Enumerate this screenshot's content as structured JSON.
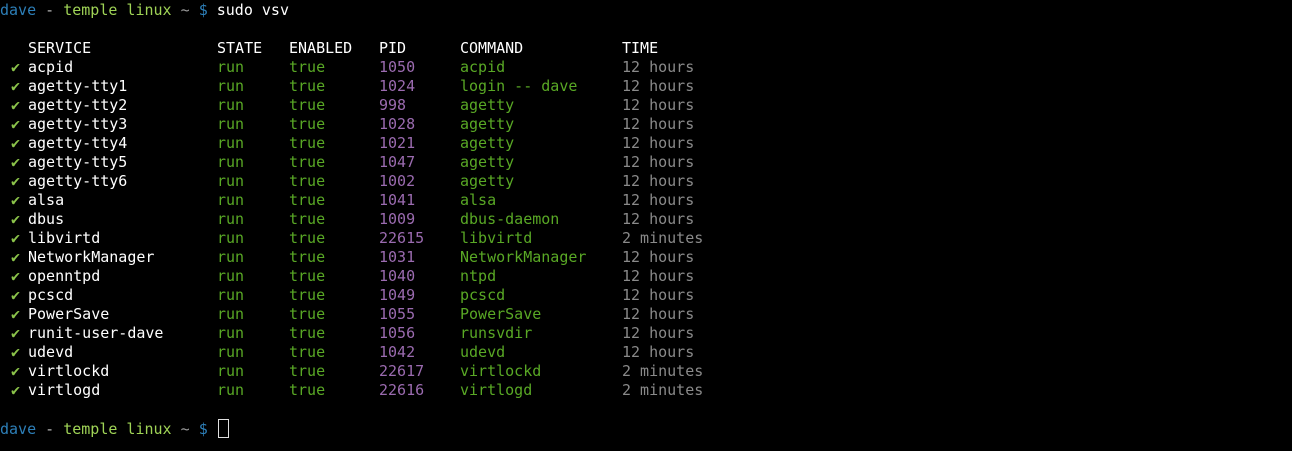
{
  "prompt": {
    "user": "dave",
    "separator": " - ",
    "host": "temple linux",
    "path": " ~ ",
    "symbol": "$"
  },
  "command": "sudo vsv",
  "columns": {
    "service": "SERVICE",
    "state": "STATE",
    "enabled": "ENABLED",
    "pid": "PID",
    "command": "COMMAND",
    "time": "TIME"
  },
  "check_symbol": "✔",
  "rows": [
    {
      "service": "acpid",
      "state": "run",
      "enabled": "true",
      "pid": "1050",
      "command": "acpid",
      "time": "12 hours"
    },
    {
      "service": "agetty-tty1",
      "state": "run",
      "enabled": "true",
      "pid": "1024",
      "command": "login -- dave",
      "time": "12 hours"
    },
    {
      "service": "agetty-tty2",
      "state": "run",
      "enabled": "true",
      "pid": "998",
      "command": "agetty",
      "time": "12 hours"
    },
    {
      "service": "agetty-tty3",
      "state": "run",
      "enabled": "true",
      "pid": "1028",
      "command": "agetty",
      "time": "12 hours"
    },
    {
      "service": "agetty-tty4",
      "state": "run",
      "enabled": "true",
      "pid": "1021",
      "command": "agetty",
      "time": "12 hours"
    },
    {
      "service": "agetty-tty5",
      "state": "run",
      "enabled": "true",
      "pid": "1047",
      "command": "agetty",
      "time": "12 hours"
    },
    {
      "service": "agetty-tty6",
      "state": "run",
      "enabled": "true",
      "pid": "1002",
      "command": "agetty",
      "time": "12 hours"
    },
    {
      "service": "alsa",
      "state": "run",
      "enabled": "true",
      "pid": "1041",
      "command": "alsa",
      "time": "12 hours"
    },
    {
      "service": "dbus",
      "state": "run",
      "enabled": "true",
      "pid": "1009",
      "command": "dbus-daemon",
      "time": "12 hours"
    },
    {
      "service": "libvirtd",
      "state": "run",
      "enabled": "true",
      "pid": "22615",
      "command": "libvirtd",
      "time": "2 minutes"
    },
    {
      "service": "NetworkManager",
      "state": "run",
      "enabled": "true",
      "pid": "1031",
      "command": "NetworkManager",
      "time": "12 hours"
    },
    {
      "service": "openntpd",
      "state": "run",
      "enabled": "true",
      "pid": "1040",
      "command": "ntpd",
      "time": "12 hours"
    },
    {
      "service": "pcscd",
      "state": "run",
      "enabled": "true",
      "pid": "1049",
      "command": "pcscd",
      "time": "12 hours"
    },
    {
      "service": "PowerSave",
      "state": "run",
      "enabled": "true",
      "pid": "1055",
      "command": "PowerSave",
      "time": "12 hours"
    },
    {
      "service": "runit-user-dave",
      "state": "run",
      "enabled": "true",
      "pid": "1056",
      "command": "runsvdir",
      "time": "12 hours"
    },
    {
      "service": "udevd",
      "state": "run",
      "enabled": "true",
      "pid": "1042",
      "command": "udevd",
      "time": "12 hours"
    },
    {
      "service": "virtlockd",
      "state": "run",
      "enabled": "true",
      "pid": "22617",
      "command": "virtlockd",
      "time": "2 minutes"
    },
    {
      "service": "virtlogd",
      "state": "run",
      "enabled": "true",
      "pid": "22616",
      "command": "virtlogd",
      "time": "2 minutes"
    }
  ],
  "colors": {
    "background": "#000000",
    "prompt_user": "#2d7fb8",
    "prompt_host": "#9fd356",
    "check": "#8bc34a",
    "state_green": "#59a825",
    "pid_purple": "#9b6bb0",
    "time_gray": "#8a8a8a"
  }
}
